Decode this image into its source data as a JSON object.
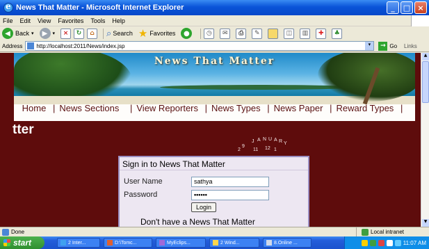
{
  "window": {
    "title": "News That Matter - Microsoft Internet Explorer"
  },
  "menu": [
    "File",
    "Edit",
    "View",
    "Favorites",
    "Tools",
    "Help"
  ],
  "toolbar": {
    "back": "Back",
    "search": "Search",
    "favorites": "Favorites"
  },
  "address": {
    "label": "Address",
    "url": "http://localhost:2011/News/index.jsp",
    "go": "Go",
    "links": "Links"
  },
  "page": {
    "banner_title": "News That Matter",
    "nav": [
      "Home",
      "News Sections",
      "View Reporters",
      "News Types",
      "News Paper",
      "Reward Types"
    ],
    "brand_fragment": "tter",
    "calendar_letters": [
      "J",
      "A",
      "N",
      "U",
      "A",
      "R",
      "Y"
    ],
    "calendar_numbers": [
      "2",
      "9",
      "11",
      "12",
      "1"
    ],
    "signin": {
      "title": "Sign in to News That Matter",
      "username_label": "User Name",
      "username_value": "sathya",
      "password_label": "Password",
      "password_value": "••••••",
      "login_button": "Login",
      "no_account": "Don't have a News That Matter"
    }
  },
  "status": {
    "text": "Done",
    "zone": "Local intranet"
  },
  "taskbar": {
    "start": "start",
    "tasks": [
      "2 Inter...",
      "D:\\Tomc...",
      "MyEclips...",
      "2 Wind...",
      "8.Online ..."
    ],
    "clock": "11:07 AM"
  }
}
